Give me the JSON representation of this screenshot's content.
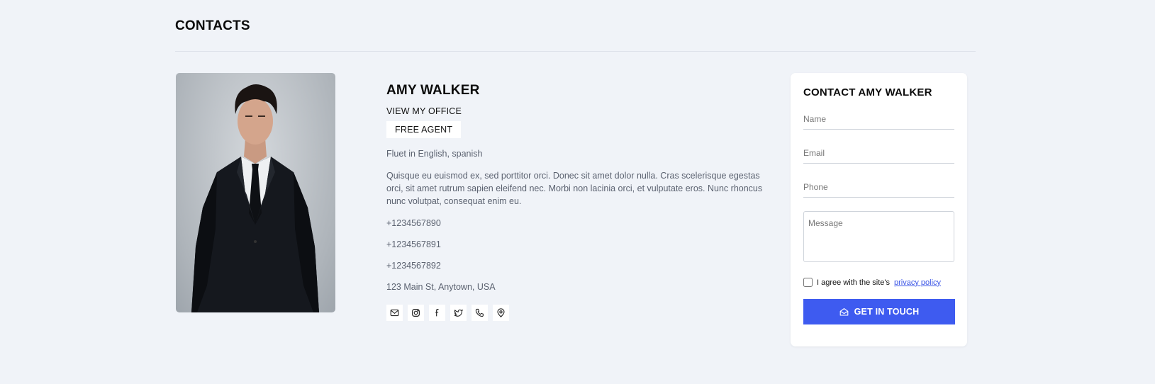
{
  "page": {
    "title": "CONTACTS"
  },
  "agent": {
    "name": "AMY WALKER",
    "office_link": "VIEW MY OFFICE",
    "badge": "FREE AGENT",
    "languages": "Fluet in English, spanish",
    "bio": "Quisque eu euismod ex, sed porttitor orci. Donec sit amet dolor nulla. Cras scelerisque egestas orci, sit amet rutrum sapien eleifend nec. Morbi non lacinia orci, et vulputate eros. Nunc rhoncus nunc volutpat, consequat enim eu.",
    "phones": [
      "+1234567890",
      "+1234567891",
      "+1234567892"
    ],
    "address": "123 Main St, Anytown, USA",
    "socials": [
      "mail-icon",
      "instagram-icon",
      "facebook-icon",
      "twitter-icon",
      "phone-icon",
      "location-icon"
    ]
  },
  "contact_form": {
    "title": "CONTACT AMY WALKER",
    "name_placeholder": "Name",
    "email_placeholder": "Email",
    "phone_placeholder": "Phone",
    "message_placeholder": "Message",
    "agree_text": "I agree with the site's",
    "policy_link": "privacy policy",
    "submit_label": "GET IN TOUCH"
  },
  "colors": {
    "background": "#f0f3f8",
    "accent": "#3e5bf0",
    "muted_text": "#5b6270"
  }
}
